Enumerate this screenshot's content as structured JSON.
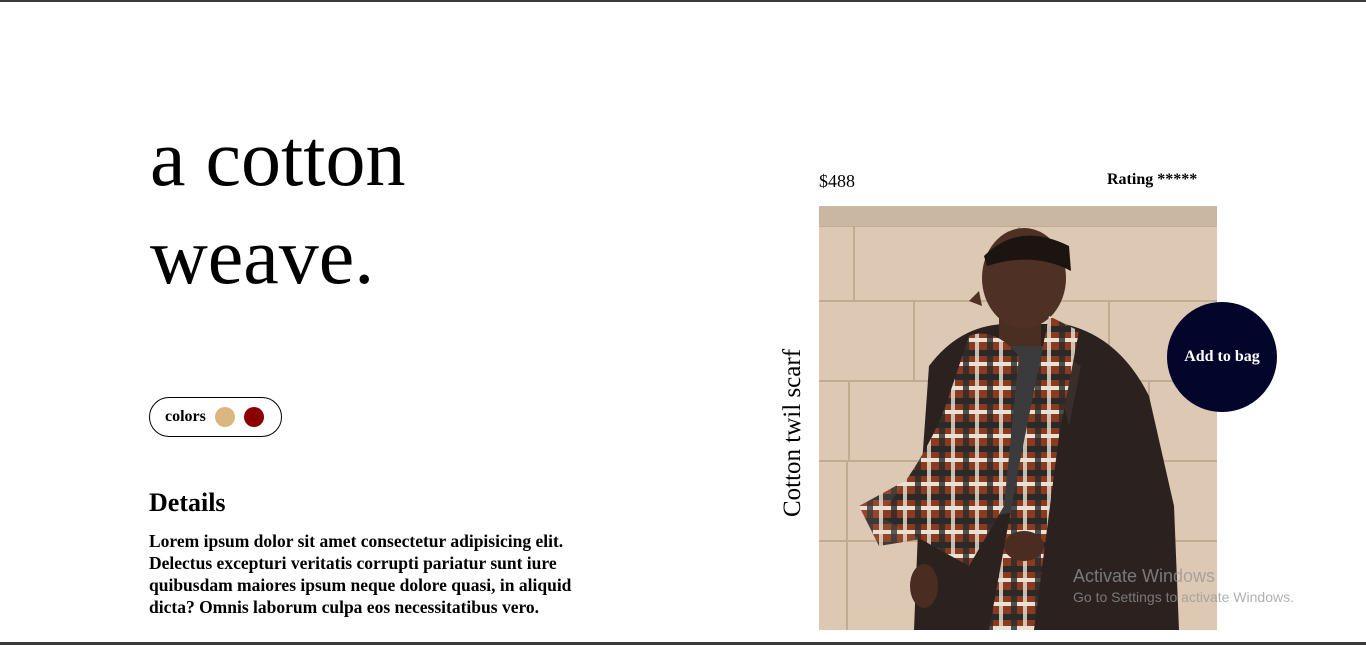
{
  "hero": {
    "line1": "a cotton",
    "line2": "weave."
  },
  "colors": {
    "label": "colors",
    "swatches": [
      {
        "name": "tan",
        "hex": "#dcb680"
      },
      {
        "name": "dark-red",
        "hex": "#8b0000"
      }
    ]
  },
  "details": {
    "heading": "Details",
    "body": "Lorem ipsum dolor sit amet consectetur adipisicing elit. Delectus excepturi veritatis corrupti pariatur sunt iure quibusdam maiores ipsum neque dolore quasi, in aliquid dicta? Omnis laborum culpa eos necessitatibus vero."
  },
  "product": {
    "price": "$488",
    "rating": "Rating *****",
    "name": "Cotton twil scarf",
    "add_to_bag_label": "Add to bag",
    "image_icon": "man-wearing-plaid-scarf-photo",
    "accent": "#03052a"
  },
  "watermark": {
    "line1": "Activate Windows",
    "line2": "Go to Settings to activate Windows."
  }
}
